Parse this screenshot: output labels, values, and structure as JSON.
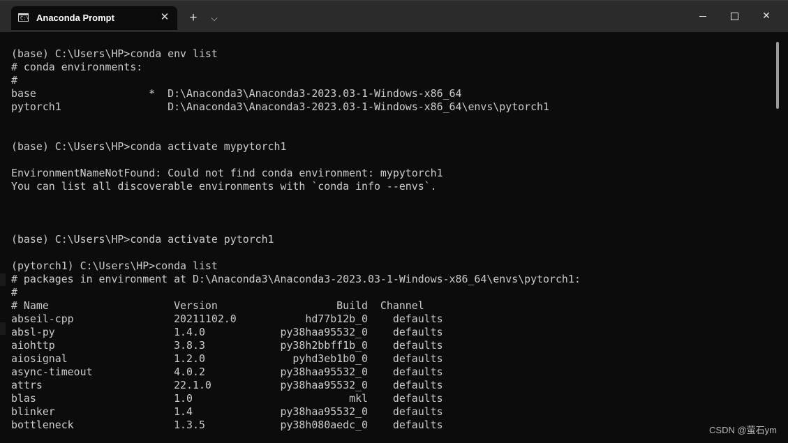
{
  "window": {
    "tab_title": "Anaconda Prompt",
    "tab_icon_text": "C:\\",
    "close_tab_glyph": "✕",
    "new_tab_glyph": "+",
    "dropdown_glyph": "⌵",
    "close_window_glyph": "✕"
  },
  "terminal": {
    "lines": [
      "(base) C:\\Users\\HP>conda env list",
      "# conda environments:",
      "#",
      "base                  *  D:\\Anaconda3\\Anaconda3-2023.03-1-Windows-x86_64",
      "pytorch1                 D:\\Anaconda3\\Anaconda3-2023.03-1-Windows-x86_64\\envs\\pytorch1",
      "",
      "",
      "(base) C:\\Users\\HP>conda activate mypytorch1",
      "",
      "EnvironmentNameNotFound: Could not find conda environment: mypytorch1",
      "You can list all discoverable environments with `conda info --envs`.",
      "",
      "",
      "",
      "(base) C:\\Users\\HP>conda activate pytorch1",
      "",
      "(pytorch1) C:\\Users\\HP>conda list",
      "# packages in environment at D:\\Anaconda3\\Anaconda3-2023.03-1-Windows-x86_64\\envs\\pytorch1:",
      "#",
      "# Name                    Version                   Build  Channel",
      "abseil-cpp                20211102.0           hd77b12b_0    defaults",
      "absl-py                   1.4.0            py38haa95532_0    defaults",
      "aiohttp                   3.8.3            py38h2bbff1b_0    defaults",
      "aiosignal                 1.2.0              pyhd3eb1b0_0    defaults",
      "async-timeout             4.0.2            py38haa95532_0    defaults",
      "attrs                     22.1.0           py38haa95532_0    defaults",
      "blas                      1.0                         mkl    defaults",
      "blinker                   1.4              py38haa95532_0    defaults",
      "bottleneck                1.3.5            py38h080aedc_0    defaults"
    ]
  },
  "watermark": "CSDN @萤石ym",
  "colors": {
    "background": "#0c0c0c",
    "titlebar": "#2b2b2b",
    "text": "#cccccc"
  }
}
